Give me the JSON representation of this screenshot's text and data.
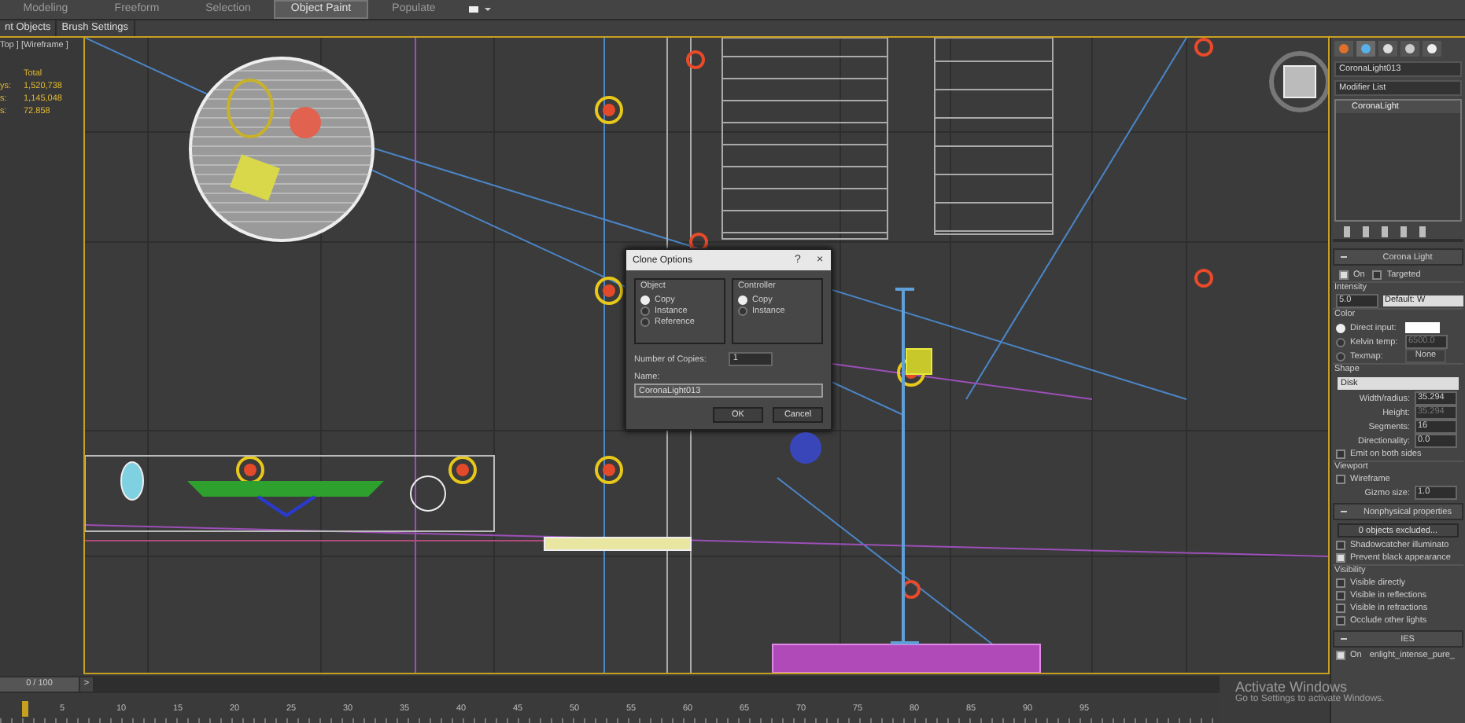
{
  "ribbon_tabs": [
    {
      "label": "Modeling",
      "selected": false
    },
    {
      "label": "Freeform",
      "selected": false
    },
    {
      "label": "Selection",
      "selected": false
    },
    {
      "label": "Object Paint",
      "selected": true
    },
    {
      "label": "Populate",
      "selected": false
    }
  ],
  "ribbon_subtabs": [
    "nt Objects",
    "Brush Settings"
  ],
  "viewport": {
    "label": "Top ] [Wireframe ]",
    "stats": [
      {
        "value": "Total"
      },
      {
        "name": "ys:",
        "value": "1,520,738"
      },
      {
        "name": "s:",
        "value": "1,145,048"
      },
      {
        "name": "s:",
        "value": "72.858"
      }
    ]
  },
  "clone_dialog": {
    "title": "Clone Options",
    "help": "?",
    "close": "×",
    "object_group": {
      "title": "Object",
      "options": [
        {
          "label": "Copy",
          "selected": true
        },
        {
          "label": "Instance",
          "selected": false
        },
        {
          "label": "Reference",
          "selected": false
        }
      ]
    },
    "controller_group": {
      "title": "Controller",
      "options": [
        {
          "label": "Copy",
          "selected": true
        },
        {
          "label": "Instance",
          "selected": false
        }
      ]
    },
    "copies_label": "Number of Copies:",
    "copies": "1",
    "name_label": "Name:",
    "name": "CoronaLight013",
    "buttons": [
      "OK",
      "Cancel"
    ]
  },
  "time_slider": {
    "label": "0 / 100",
    "next": ">",
    "level": 0
  },
  "ruler_ticks": [
    "5",
    "10",
    "15",
    "20",
    "25",
    "30",
    "35",
    "40",
    "45",
    "50",
    "55",
    "60",
    "65",
    "70",
    "75",
    "80",
    "85",
    "90",
    "95"
  ],
  "command_panel": {
    "object_name": "CoronaLight013",
    "modifier_list": "Modifier List",
    "stack": [
      "CoronaLight"
    ],
    "corona_light": {
      "title": "Corona Light",
      "on": {
        "label": "On",
        "checked": true
      },
      "targeted": {
        "label": "Targeted",
        "checked": false
      },
      "intensity_label": "Intensity",
      "intensity": "5.0",
      "unit": "Default: W",
      "color_label": "Color",
      "color_options": [
        {
          "label": "Direct input:",
          "selected": true,
          "kind": "swatch"
        },
        {
          "label": "Kelvin temp:",
          "selected": false,
          "kind": "kelvin",
          "value": "6500.0"
        },
        {
          "label": "Texmap:",
          "selected": false,
          "kind": "texmap",
          "value": "None"
        }
      ],
      "shape_label": "Shape",
      "shape": "Disk",
      "spinners": [
        {
          "label": "Width/radius:",
          "value": "35.294",
          "disabled": false
        },
        {
          "label": "Height:",
          "value": "35.294",
          "disabled": true
        },
        {
          "label": "Segments:",
          "value": "16",
          "disabled": false
        },
        {
          "label": "Directionality:",
          "value": "0.0",
          "disabled": false
        }
      ],
      "emit_both": {
        "label": "Emit on both sides",
        "checked": false
      },
      "viewport_label": "Viewport",
      "wireframe": {
        "label": "Wireframe",
        "checked": false
      },
      "gizmo_label": "Gizmo size:",
      "gizmo": "1.0"
    },
    "nonphysical": {
      "title": "Nonphysical properties",
      "excluded": "0 objects excluded...",
      "checks": [
        {
          "label": "Shadowcatcher illuminato",
          "checked": false
        },
        {
          "label": "Prevent black appearance",
          "checked": true
        }
      ],
      "visibility_label": "Visibility",
      "visibility": [
        {
          "label": "Visible directly",
          "checked": false
        },
        {
          "label": "Visible in reflections",
          "checked": false
        },
        {
          "label": "Visible in refractions",
          "checked": false
        },
        {
          "label": "Occlude other lights",
          "checked": false
        }
      ]
    },
    "ies": {
      "title": "IES",
      "on": {
        "label": "On",
        "checked": true
      },
      "file": "enlight_intense_pure_"
    }
  },
  "os_notice": {
    "title": "Activate Windows",
    "text": "Go to Settings to activate Windows."
  }
}
